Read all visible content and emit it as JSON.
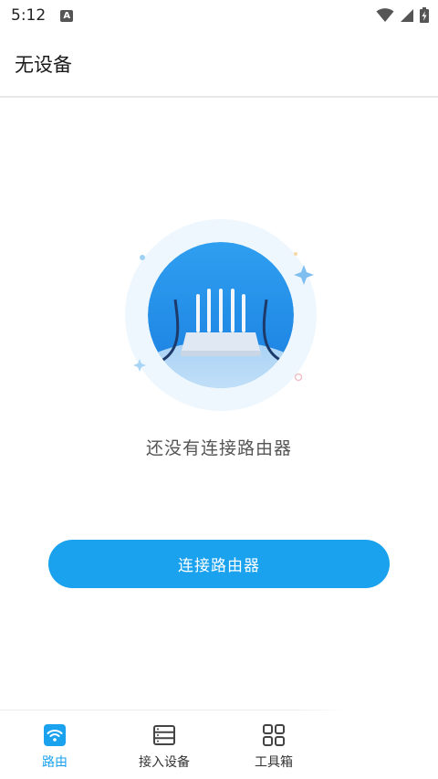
{
  "status_bar": {
    "time": "5:12",
    "notification_badge": "A",
    "icons": [
      "wifi-icon",
      "signal-icon",
      "battery-charging-icon"
    ]
  },
  "app_bar": {
    "title": "无设备"
  },
  "empty_state": {
    "illustration_icon": "router-icon",
    "message": "还没有连接路由器"
  },
  "actions": {
    "connect_label": "连接路由器"
  },
  "bottom_nav": {
    "items": [
      {
        "label": "路由",
        "icon": "wifi-router-icon",
        "active": true
      },
      {
        "label": "接入设备",
        "icon": "device-list-icon",
        "active": false
      },
      {
        "label": "工具箱",
        "icon": "grid-icon",
        "active": false
      }
    ]
  },
  "colors": {
    "accent": "#1aa2ee",
    "divider": "#e8e8e8"
  }
}
